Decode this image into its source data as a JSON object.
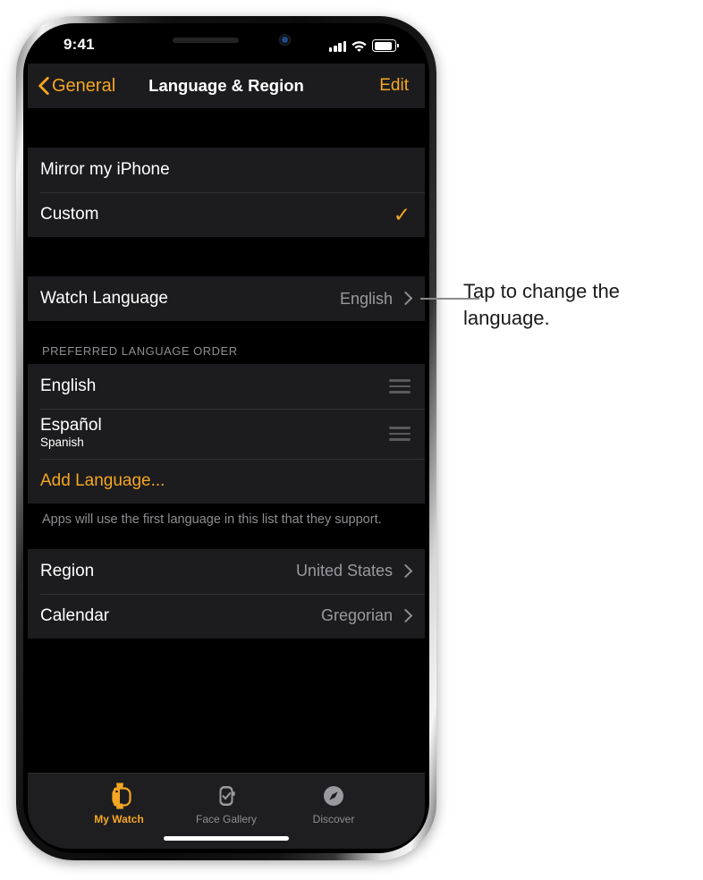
{
  "status_bar": {
    "time": "9:41",
    "cellular_icon": "signal-bars-icon",
    "wifi_icon": "wifi-icon",
    "battery_icon": "battery-icon"
  },
  "nav_bar": {
    "back_label": "General",
    "back_icon": "chevron-left-icon",
    "title": "Language & Region",
    "edit_label": "Edit"
  },
  "sections": {
    "mirror": {
      "rows": [
        {
          "label": "Mirror my iPhone",
          "accessory": "none"
        },
        {
          "label": "Custom",
          "accessory": "checkmark",
          "check_glyph": "✓"
        }
      ]
    },
    "watch_language": {
      "label": "Watch Language",
      "value": "English",
      "accessory": "chevron-right-icon"
    },
    "preferred_order": {
      "header": "PREFERRED LANGUAGE ORDER",
      "rows": [
        {
          "label": "English",
          "secondary": "",
          "accessory": "reorder-handle-icon"
        },
        {
          "label": "Español",
          "secondary": "Spanish",
          "accessory": "reorder-handle-icon"
        }
      ],
      "add_label": "Add Language...",
      "footer": "Apps will use the first language in this list that they support."
    },
    "region": {
      "rows": [
        {
          "label": "Region",
          "value": "United States",
          "accessory": "chevron-right-icon"
        },
        {
          "label": "Calendar",
          "value": "Gregorian",
          "accessory": "chevron-right-icon"
        }
      ]
    }
  },
  "tab_bar": {
    "tabs": [
      {
        "label": "My Watch",
        "icon": "watch-icon",
        "active": true
      },
      {
        "label": "Face Gallery",
        "icon": "watch-face-check-icon",
        "active": false
      },
      {
        "label": "Discover",
        "icon": "compass-icon",
        "active": false
      }
    ]
  },
  "callout": {
    "text": "Tap to change the language."
  },
  "colors": {
    "accent": "#f5a623",
    "row_bg": "#1c1c1e",
    "page_bg": "#000000",
    "secondary_text": "#8e8e93"
  }
}
